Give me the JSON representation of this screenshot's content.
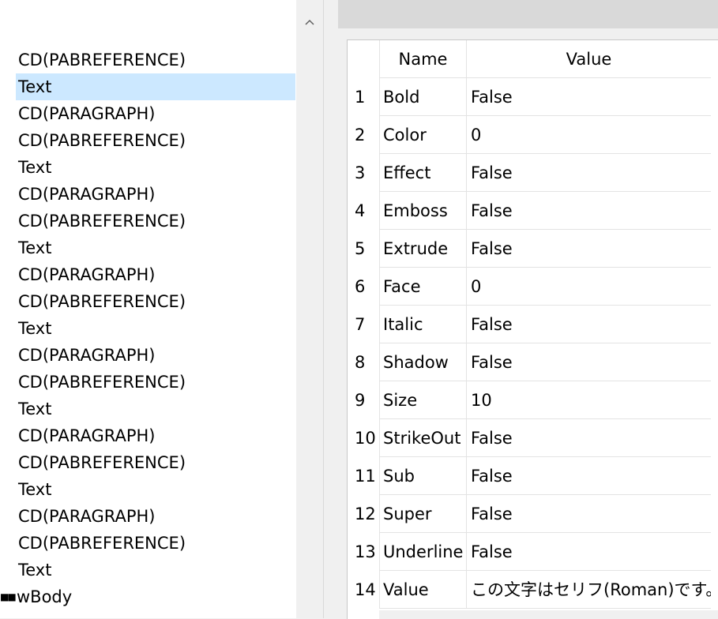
{
  "tree": {
    "items": [
      {
        "label": "CD(PABREFERENCE)"
      },
      {
        "label": "Text",
        "selected": true
      },
      {
        "label": "CD(PARAGRAPH)"
      },
      {
        "label": "CD(PABREFERENCE)"
      },
      {
        "label": "Text"
      },
      {
        "label": "CD(PARAGRAPH)"
      },
      {
        "label": "CD(PABREFERENCE)"
      },
      {
        "label": "Text"
      },
      {
        "label": "CD(PARAGRAPH)"
      },
      {
        "label": "CD(PABREFERENCE)"
      },
      {
        "label": "Text"
      },
      {
        "label": "CD(PARAGRAPH)"
      },
      {
        "label": "CD(PABREFERENCE)"
      },
      {
        "label": "Text"
      },
      {
        "label": "CD(PARAGRAPH)"
      },
      {
        "label": "CD(PABREFERENCE)"
      },
      {
        "label": "Text"
      },
      {
        "label": "CD(PARAGRAPH)"
      },
      {
        "label": "CD(PABREFERENCE)"
      },
      {
        "label": "Text"
      }
    ],
    "parent_node": {
      "label": "wBody",
      "icon": "node-connector-icon"
    },
    "selection_color": "#cce8ff"
  },
  "scrollbar": {
    "up_icon": "chevron-up-icon"
  },
  "properties": {
    "columns": {
      "name": "Name",
      "value": "Value"
    },
    "rows": [
      {
        "index": "1",
        "name": "Bold",
        "value": "False"
      },
      {
        "index": "2",
        "name": "Color",
        "value": "0"
      },
      {
        "index": "3",
        "name": "Effect",
        "value": "False"
      },
      {
        "index": "4",
        "name": "Emboss",
        "value": "False"
      },
      {
        "index": "5",
        "name": "Extrude",
        "value": "False"
      },
      {
        "index": "6",
        "name": "Face",
        "value": "0"
      },
      {
        "index": "7",
        "name": "Italic",
        "value": "False"
      },
      {
        "index": "8",
        "name": "Shadow",
        "value": "False"
      },
      {
        "index": "9",
        "name": "Size",
        "value": "10"
      },
      {
        "index": "10",
        "name": "StrikeOut",
        "value": "False"
      },
      {
        "index": "11",
        "name": "Sub",
        "value": "False"
      },
      {
        "index": "12",
        "name": "Super",
        "value": "False"
      },
      {
        "index": "13",
        "name": "Underline",
        "value": "False"
      },
      {
        "index": "14",
        "name": "Value",
        "value": "この文字はセリフ(Roman)です。"
      }
    ]
  }
}
